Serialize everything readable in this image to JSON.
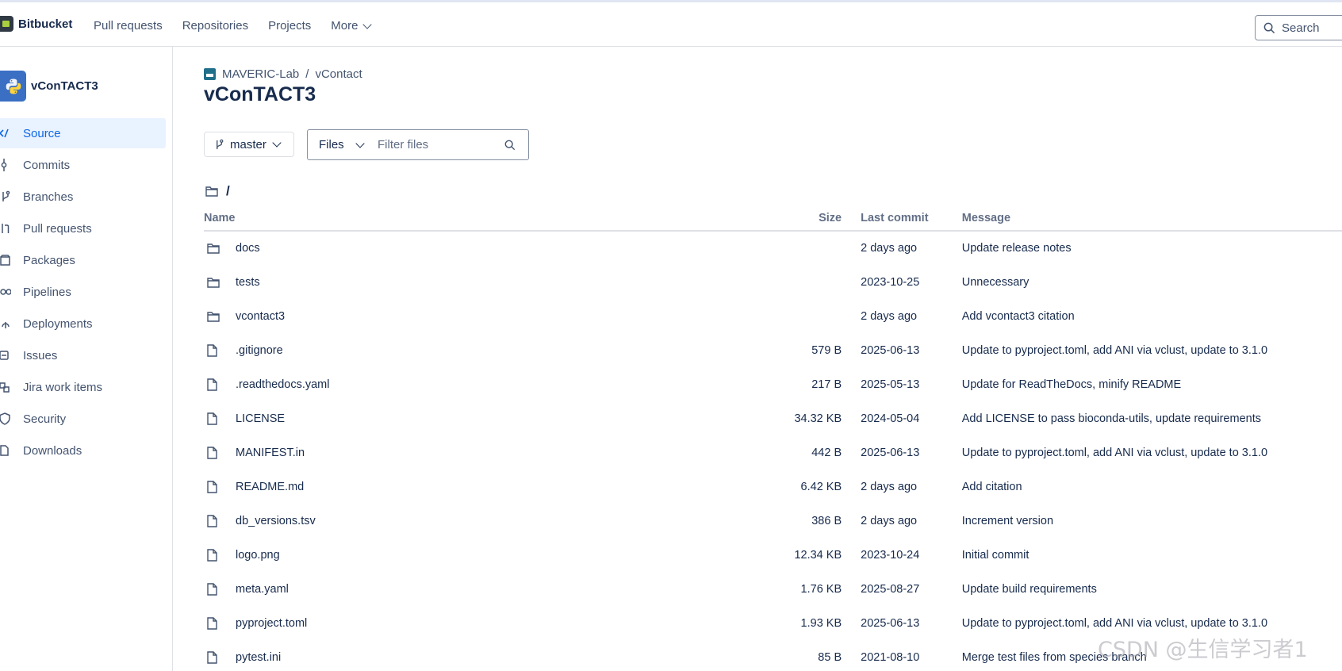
{
  "topbar": {
    "brand": "Bitbucket",
    "nav": [
      {
        "label": "Pull requests"
      },
      {
        "label": "Repositories"
      },
      {
        "label": "Projects"
      },
      {
        "label": "More"
      }
    ],
    "search_placeholder": "Search"
  },
  "sidebar": {
    "repo_name": "vConTACT3",
    "items": [
      {
        "label": "Source",
        "icon": "code-icon",
        "active": true
      },
      {
        "label": "Commits",
        "icon": "commit-icon"
      },
      {
        "label": "Branches",
        "icon": "branch-icon"
      },
      {
        "label": "Pull requests",
        "icon": "pull-request-icon"
      },
      {
        "label": "Packages",
        "icon": "package-icon"
      },
      {
        "label": "Pipelines",
        "icon": "pipeline-icon"
      },
      {
        "label": "Deployments",
        "icon": "deployment-icon"
      },
      {
        "label": "Issues",
        "icon": "issues-icon"
      },
      {
        "label": "Jira work items",
        "icon": "jira-icon"
      },
      {
        "label": "Security",
        "icon": "shield-icon"
      },
      {
        "label": "Downloads",
        "icon": "download-icon"
      }
    ]
  },
  "main": {
    "breadcrumb": {
      "project": "MAVERIC-Lab",
      "separator": "/",
      "repo": "vContact"
    },
    "title": "vConTACT3",
    "branch": "master",
    "files_select": "Files",
    "filter_placeholder": "Filter files",
    "path": "/",
    "columns": {
      "name": "Name",
      "size": "Size",
      "last_commit": "Last commit",
      "message": "Message"
    },
    "rows": [
      {
        "type": "folder",
        "name": "docs",
        "size": "",
        "date": "2 days ago",
        "message": "Update release notes"
      },
      {
        "type": "folder",
        "name": "tests",
        "size": "",
        "date": "2023-10-25",
        "message": "Unnecessary"
      },
      {
        "type": "folder",
        "name": "vcontact3",
        "size": "",
        "date": "2 days ago",
        "message": "Add vcontact3 citation"
      },
      {
        "type": "file",
        "name": ".gitignore",
        "size": "579 B",
        "date": "2025-06-13",
        "message": "Update to pyproject.toml, add ANI via vclust, update to 3.1.0"
      },
      {
        "type": "file",
        "name": ".readthedocs.yaml",
        "size": "217 B",
        "date": "2025-05-13",
        "message": "Update for ReadTheDocs, minify README"
      },
      {
        "type": "file",
        "name": "LICENSE",
        "size": "34.32 KB",
        "date": "2024-05-04",
        "message": "Add LICENSE to pass bioconda-utils, update requirements"
      },
      {
        "type": "file",
        "name": "MANIFEST.in",
        "size": "442 B",
        "date": "2025-06-13",
        "message": "Update to pyproject.toml, add ANI via vclust, update to 3.1.0"
      },
      {
        "type": "file",
        "name": "README.md",
        "size": "6.42 KB",
        "date": "2 days ago",
        "message": "Add citation"
      },
      {
        "type": "file",
        "name": "db_versions.tsv",
        "size": "386 B",
        "date": "2 days ago",
        "message": "Increment version"
      },
      {
        "type": "file",
        "name": "logo.png",
        "size": "12.34 KB",
        "date": "2023-10-24",
        "message": "Initial commit"
      },
      {
        "type": "file",
        "name": "meta.yaml",
        "size": "1.76 KB",
        "date": "2025-08-27",
        "message": "Update build requirements"
      },
      {
        "type": "file",
        "name": "pyproject.toml",
        "size": "1.93 KB",
        "date": "2025-06-13",
        "message": "Update to pyproject.toml, add ANI via vclust, update to 3.1.0"
      },
      {
        "type": "file",
        "name": "pytest.ini",
        "size": "85 B",
        "date": "2021-08-10",
        "message": "Merge test files from species branch"
      }
    ]
  },
  "watermark": "CSDN @生信学习者1",
  "colors": {
    "accent": "#0c66e4",
    "active_bg": "#e9f2ff",
    "text": "#172b4d",
    "muted": "#44546f"
  }
}
